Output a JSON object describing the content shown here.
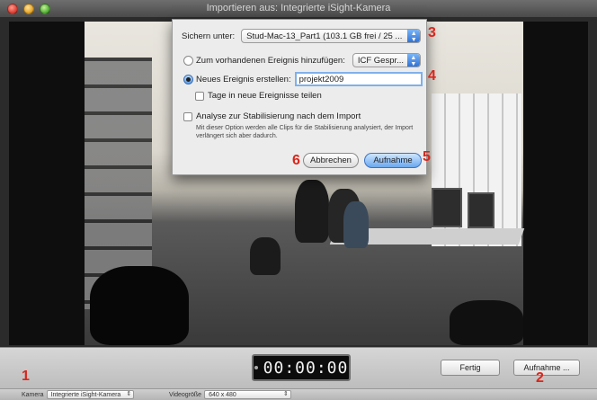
{
  "window": {
    "title": "Importieren aus: Integrierte iSight-Kamera"
  },
  "dialog": {
    "save_label": "Sichern unter:",
    "save_value": "Stud-Mac-13_Part1 (103.1 GB frei / 25 ...",
    "existing_event_label": "Zum vorhandenen Ereignis hinzufügen:",
    "existing_event_value": "ICF Gespr...",
    "new_event_label": "Neues Ereignis erstellen:",
    "new_event_value": "projekt2009",
    "split_days_label": "Tage in neue Ereignisse teilen",
    "stabilize_label": "Analyse zur Stabilisierung nach dem Import",
    "stabilize_note": "Mit dieser Option werden alle Clips für die Stabilisierung analysiert, der Import verlängert sich aber dadurch.",
    "cancel_label": "Abbrechen",
    "record_label": "Aufnahme"
  },
  "markers": [
    "1",
    "2",
    "3",
    "4",
    "5",
    "6"
  ],
  "controls": {
    "timecode": "00:00:00",
    "done_label": "Fertig",
    "record_label": "Aufnahme ..."
  },
  "status": {
    "camera_label": "Kamera",
    "camera_value": "Integrierte iSight-Kamera",
    "video_size_label": "Videogröße",
    "video_size_value": "640 x 480"
  },
  "colors": {
    "marker": "#d9261c",
    "default_button": "#6aa8ef"
  }
}
